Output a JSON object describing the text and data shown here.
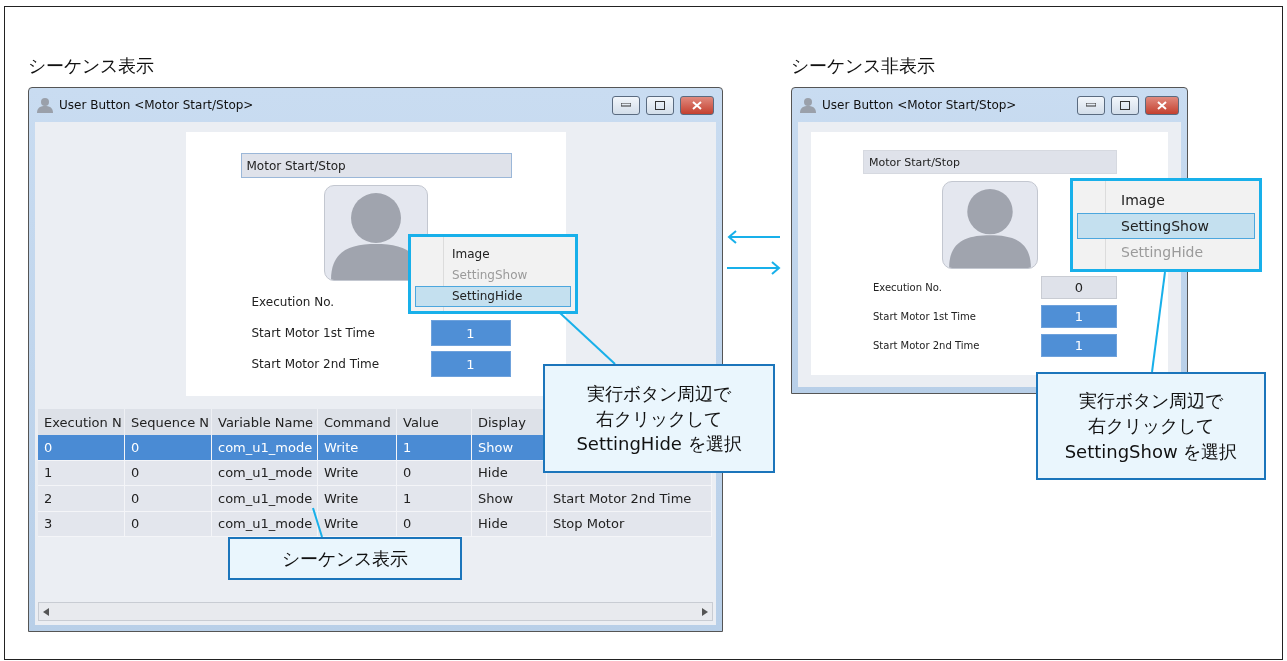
{
  "panels": [
    {
      "heading": "シーケンス表示",
      "window": {
        "title": "User Button <Motor Start/Stop>",
        "name_field": "Motor Start/Stop",
        "fields": [
          {
            "label": "Execution No."
          },
          {
            "label": "Start Motor 1st Time",
            "value": "1",
            "kind": "active"
          },
          {
            "label": "Start Motor 2nd Time",
            "value": "1",
            "kind": "active"
          }
        ],
        "context_menu": [
          {
            "label": "Image",
            "disabled": false,
            "selected": false
          },
          {
            "label": "SettingShow",
            "disabled": true,
            "selected": false
          },
          {
            "label": "SettingHide",
            "disabled": false,
            "selected": true
          }
        ],
        "table": {
          "columns": [
            "Execution N",
            "Sequence N",
            "Variable Name",
            "Command",
            "Value",
            "Display"
          ],
          "rows": [
            {
              "selected": true,
              "cells": [
                "0",
                "0",
                "com_u1_mode",
                "Write",
                "1",
                "Show"
              ]
            },
            {
              "selected": false,
              "cells": [
                "1",
                "0",
                "com_u1_mode",
                "Write",
                "0",
                "Hide"
              ]
            },
            {
              "selected": false,
              "cells": [
                "2",
                "0",
                "com_u1_mode",
                "Write",
                "1",
                "Show",
                "Start Motor 2nd Time"
              ]
            },
            {
              "selected": false,
              "cells": [
                "3",
                "0",
                "com_u1_mode",
                "Write",
                "0",
                "Hide",
                "Stop Motor"
              ]
            }
          ]
        }
      },
      "callout": [
        "実行ボタン周辺で",
        "右クリックして",
        "SettingHide を選択"
      ],
      "table_callout": [
        "シーケンス表示"
      ]
    },
    {
      "heading": "シーケンス非表示",
      "window": {
        "title": "User Button <Motor Start/Stop>",
        "name_field": "Motor Start/Stop",
        "fields": [
          {
            "label": "Execution No.",
            "value": "0",
            "kind": "readonly"
          },
          {
            "label": "Start Motor 1st Time",
            "value": "1",
            "kind": "active"
          },
          {
            "label": "Start Motor 2nd Time",
            "value": "1",
            "kind": "active"
          }
        ],
        "context_menu": [
          {
            "label": "Image",
            "disabled": false,
            "selected": false
          },
          {
            "label": "SettingShow",
            "disabled": false,
            "selected": true
          },
          {
            "label": "SettingHide",
            "disabled": true,
            "selected": false
          }
        ]
      },
      "callout": [
        "実行ボタン周辺で",
        "右クリックして",
        "SettingShow を選択"
      ]
    }
  ]
}
